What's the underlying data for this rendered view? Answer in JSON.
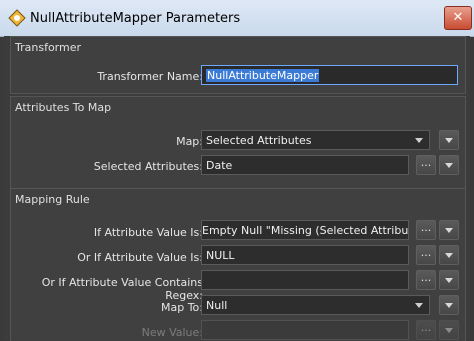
{
  "window": {
    "title": "NullAttributeMapper Parameters",
    "close_label": "✕"
  },
  "transformer": {
    "section_title": "Transformer",
    "name_label": "Transformer Name:",
    "name_value": "NullAttributeMapper"
  },
  "attributes": {
    "section_title": "Attributes To Map",
    "map_label": "Map:",
    "map_value": "Selected Attributes",
    "selected_label": "Selected Attributes:",
    "selected_value": "Date"
  },
  "mapping": {
    "section_title": "Mapping Rule",
    "if_label": "If Attribute Value Is:",
    "if_value": "Empty Null \"Missing (Selected Attributes Only)\"",
    "or_label": "Or If Attribute Value Is:",
    "or_value": "NULL",
    "regex_label": "Or If Attribute Value Contains Regex:",
    "regex_value": "",
    "mapto_label": "Map To:",
    "mapto_value": "Null",
    "newvalue_label": "New Value:",
    "newvalue_value": ""
  },
  "buttons": {
    "ellipsis": "..."
  }
}
